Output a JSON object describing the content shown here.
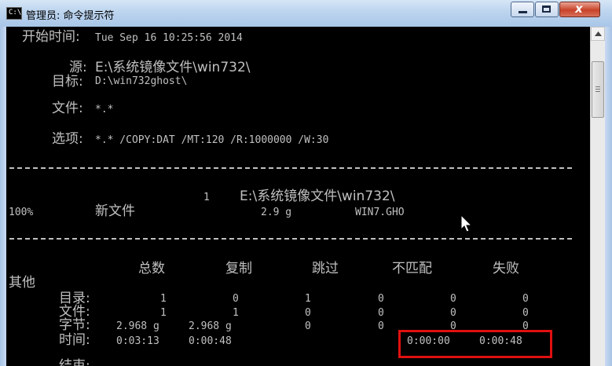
{
  "window": {
    "title": "管理员: 命令提示符",
    "app_icon_text": "C:\\",
    "close_symbol": "x"
  },
  "console": {
    "start_label": "开始时间:",
    "start_value": "Tue Sep 16 10:25:56 2014",
    "source_label": "源:",
    "source_value": "E:\\系统镜像文件\\win732\\",
    "dest_label": "目标:",
    "dest_value": "D:\\win732ghost\\",
    "files_label": "文件:",
    "files_value": "*.*",
    "options_label": "选项:",
    "options_value": "*.* /COPY:DAT /MT:120 /R:1000000 /W:30",
    "job": {
      "dir_count": "1",
      "dir_path": "E:\\系统镜像文件\\win732\\",
      "percent": "100%",
      "status": "新文件",
      "size": "2.9 g",
      "filename": "WIN7.GHO"
    },
    "summary": {
      "side_label": "其他",
      "headers": [
        "总数",
        "复制",
        "跳过",
        "不匹配",
        "失败"
      ],
      "rows": [
        {
          "label": "目录:",
          "values": [
            "1",
            "0",
            "1",
            "0",
            "0",
            "0"
          ]
        },
        {
          "label": "文件:",
          "values": [
            "1",
            "1",
            "0",
            "0",
            "0",
            "0"
          ]
        },
        {
          "label": "字节:",
          "values": [
            "2.968 g",
            "2.968 g",
            "0",
            "0",
            "0",
            "0"
          ]
        },
        {
          "label": "时间:",
          "values": [
            "0:03:13",
            "0:00:48",
            "",
            "",
            "0:00:00",
            "0:00:48"
          ]
        }
      ],
      "cutoff_label": "结束:"
    }
  },
  "colors": {
    "console_text": "#c0c0c0",
    "console_bg": "#000000",
    "highlight_border": "#e01010",
    "titlebar": "#bcd4ee"
  }
}
